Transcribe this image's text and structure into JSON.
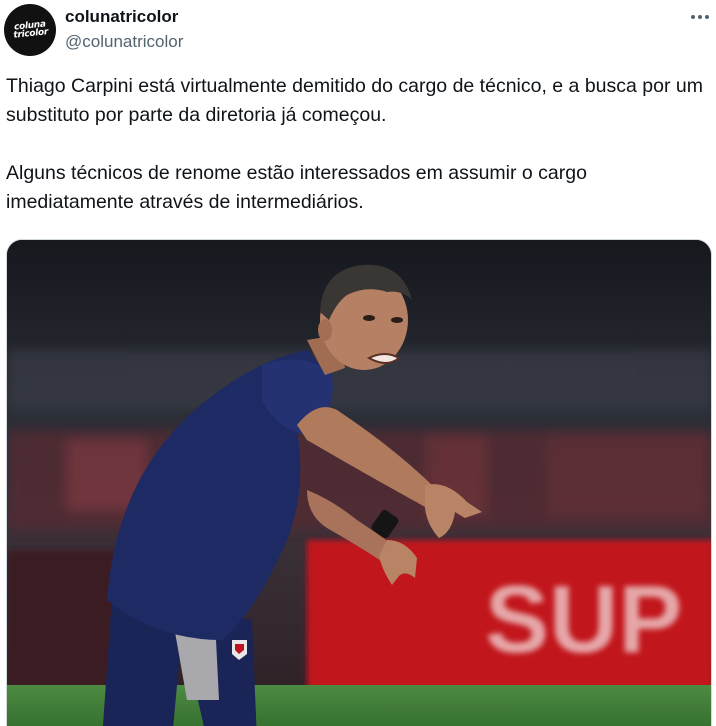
{
  "author": {
    "display_name": "colunatricolor",
    "handle": "@colunatricolor",
    "avatar_logo_text": "coluna tricolor"
  },
  "tweet": {
    "paragraphs": [
      "Thiago Carpini está virtualmente demitido do cargo de técnico, e a busca por um substituto por parte da diretoria já começou.",
      "Alguns técnicos de renome estão interessados em assumir o cargo imediatamente através de intermediários."
    ]
  },
  "media": {
    "description_icon": "photo",
    "background_sign_text": "SUP",
    "colors": {
      "shirt": "#1e2a63",
      "sign_red": "#c1121f",
      "pitch_green": "#3d7a35"
    }
  },
  "icons": {
    "more": "more-horizontal-icon"
  }
}
